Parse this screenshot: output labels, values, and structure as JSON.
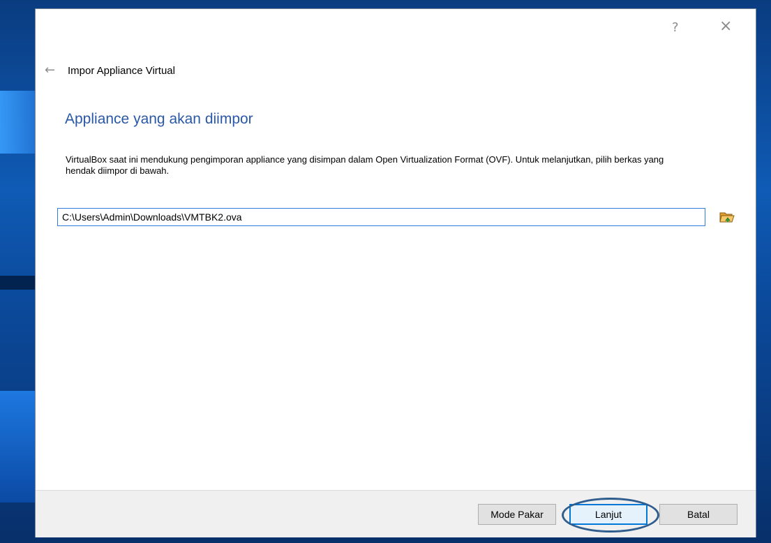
{
  "window": {
    "help_label": "?",
    "close_label": "×"
  },
  "header": {
    "back_glyph": "←",
    "title": "Impor Appliance Virtual"
  },
  "page": {
    "heading": "Appliance yang akan diimpor",
    "description": "VirtualBox saat ini mendukung pengimporan appliance yang disimpan dalam Open Virtualization Format (OVF). Untuk melanjutkan, pilih berkas yang hendak diimpor di bawah."
  },
  "file_picker": {
    "value": "C:\\Users\\Admin\\Downloads\\VMTBK2.ova",
    "icon": "folder-open-icon"
  },
  "footer": {
    "expert_label": "Mode Pakar",
    "next_label": "Lanjut",
    "cancel_label": "Batal"
  },
  "colors": {
    "heading": "#2a58a8",
    "input_border": "#2f7ce0",
    "annotation": "#2f5d8e"
  }
}
